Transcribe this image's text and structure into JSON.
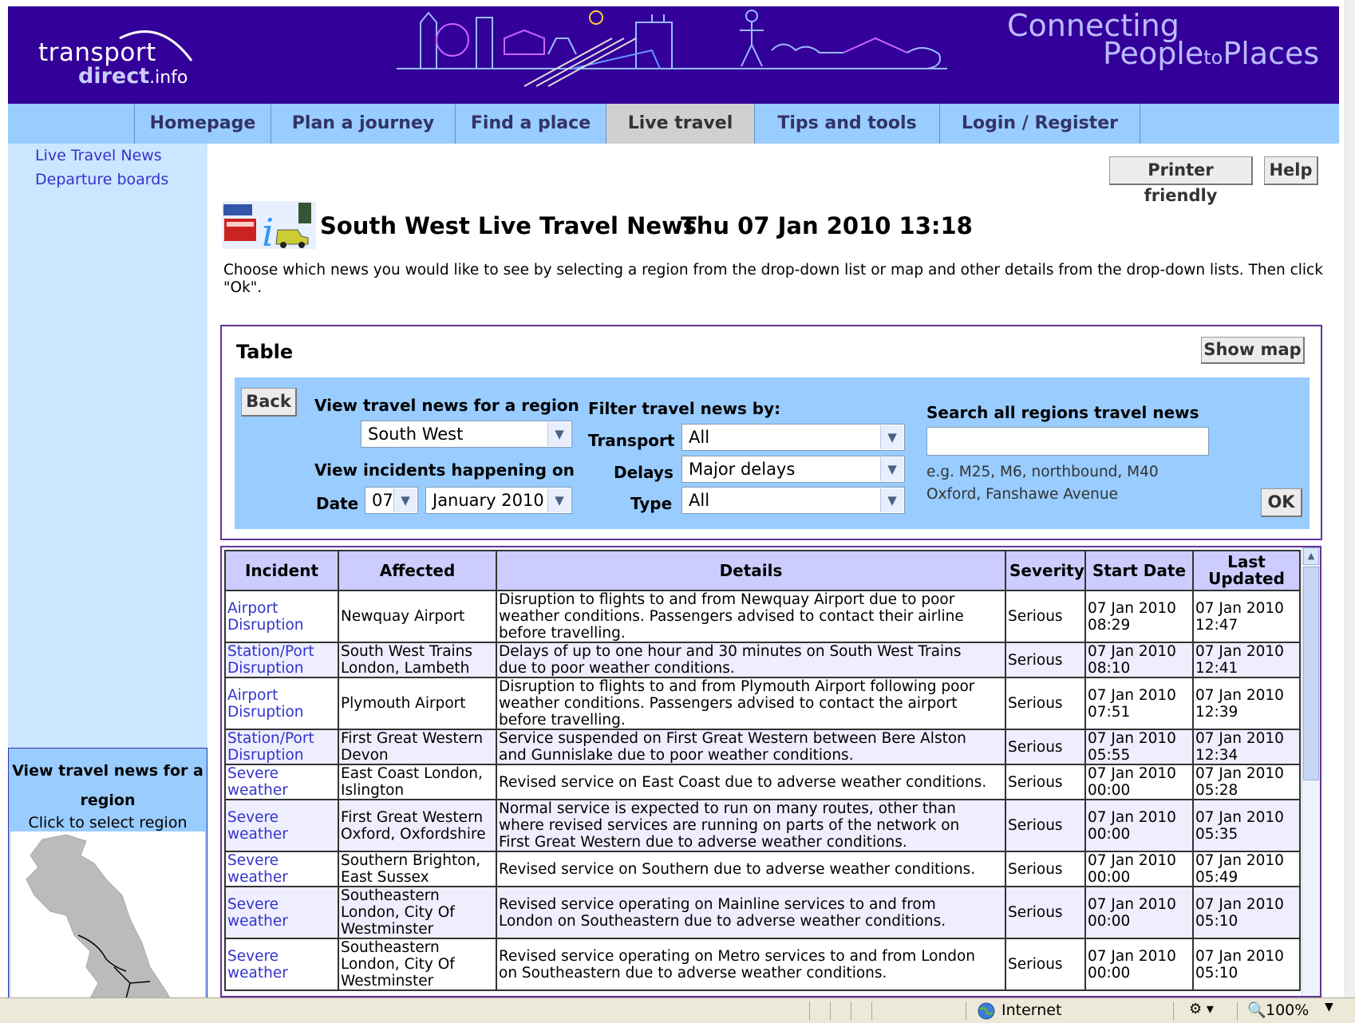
{
  "header": {
    "logo_line1": "transport",
    "logo_line2": "direct",
    "logo_suffix": ".info",
    "tagline_line1": "Connecting",
    "tagline_people": "People",
    "tagline_to": "to",
    "tagline_places": "Places",
    "colors": {
      "banner": "#330099",
      "nav": "#99ccff"
    }
  },
  "nav": {
    "items": [
      {
        "label": "Homepage"
      },
      {
        "label": "Plan a journey"
      },
      {
        "label": "Find a place"
      },
      {
        "label": "Live travel",
        "active": true
      },
      {
        "label": "Tips and tools"
      },
      {
        "label": "Login / Register"
      }
    ]
  },
  "sidebar": {
    "links": [
      {
        "label": "Live Travel News"
      },
      {
        "label": "Departure boards"
      }
    ],
    "region_panel": {
      "title_line1": "View travel news for a",
      "title_line2": "region",
      "subtitle": "Click to select region"
    }
  },
  "toolbar": {
    "printer_friendly": "Printer friendly",
    "help": "Help"
  },
  "page": {
    "title": "South West Live Travel News",
    "datetime": "Thu 07 Jan 2010 13:18",
    "intro": "Choose which news you would like to see by selecting a region from the drop-down list or map and other details from the drop-down lists. Then click \"Ok\"."
  },
  "filter": {
    "heading": "Table",
    "show_map": "Show map",
    "back": "Back",
    "region_label": "View travel news for a region",
    "region_value": "South West",
    "incidents_label": "View incidents happening on",
    "date_label": "Date",
    "day_value": "07",
    "month_value": "January 2010",
    "filter_label": "Filter travel news by:",
    "transport_label": "Transport",
    "transport_value": "All",
    "delays_label": "Delays",
    "delays_value": "Major delays",
    "type_label": "Type",
    "type_value": "All",
    "search_label": "Search all regions travel news",
    "search_value": "",
    "hint_line1": "e.g. M25, M6, northbound, M40",
    "hint_line2": "Oxford, Fanshawe Avenue",
    "ok": "OK"
  },
  "table": {
    "headers": [
      "Incident",
      "Affected",
      "Details",
      "Severity",
      "Start Date",
      "Last Updated"
    ],
    "rows": [
      {
        "incident": [
          "Airport",
          "Disruption"
        ],
        "affected": [
          "Newquay Airport"
        ],
        "details": [
          "Disruption to flights to and from Newquay Airport due to poor",
          "weather conditions. Passengers advised to contact their airline",
          "before travelling."
        ],
        "severity": "Serious",
        "start": [
          "07 Jan 2010",
          "08:29"
        ],
        "updated": [
          "07 Jan 2010",
          "12:47"
        ]
      },
      {
        "incident": [
          "Station/Port",
          "Disruption"
        ],
        "affected": [
          "South West Trains",
          "London, Lambeth"
        ],
        "details": [
          "Delays of up to one hour and 30 minutes on South West Trains",
          "due to poor weather conditions."
        ],
        "severity": "Serious",
        "start": [
          "07 Jan 2010",
          "08:10"
        ],
        "updated": [
          "07 Jan 2010",
          "12:41"
        ]
      },
      {
        "incident": [
          "Airport",
          "Disruption"
        ],
        "affected": [
          "Plymouth Airport"
        ],
        "details": [
          "Disruption to flights to and from Plymouth Airport following poor",
          "weather conditions. Passengers advised to contact the airport",
          "before travelling."
        ],
        "severity": "Serious",
        "start": [
          "07 Jan 2010",
          "07:51"
        ],
        "updated": [
          "07 Jan 2010",
          "12:39"
        ]
      },
      {
        "incident": [
          "Station/Port",
          "Disruption"
        ],
        "affected": [
          "First Great Western",
          "Devon"
        ],
        "details": [
          "Service suspended on First Great Western between Bere Alston",
          "and Gunnislake due to poor weather conditions."
        ],
        "severity": "Serious",
        "start": [
          "07 Jan 2010",
          "05:55"
        ],
        "updated": [
          "07 Jan 2010",
          "12:34"
        ]
      },
      {
        "incident": [
          "Severe",
          "weather"
        ],
        "affected": [
          "East Coast London,",
          "Islington"
        ],
        "details": [
          "Revised service on East Coast due to adverse weather conditions."
        ],
        "severity": "Serious",
        "start": [
          "07 Jan 2010",
          "00:00"
        ],
        "updated": [
          "07 Jan 2010",
          "05:28"
        ]
      },
      {
        "incident": [
          "Severe",
          "weather"
        ],
        "affected": [
          "First Great Western",
          "Oxford, Oxfordshire"
        ],
        "details": [
          "Normal service is expected to run on many routes, other than",
          "where revised services are running on parts of the network on",
          "First Great Western due to adverse weather conditions."
        ],
        "severity": "Serious",
        "start": [
          "07 Jan 2010",
          "00:00"
        ],
        "updated": [
          "07 Jan 2010",
          "05:35"
        ]
      },
      {
        "incident": [
          "Severe",
          "weather"
        ],
        "affected": [
          "Southern Brighton,",
          "East Sussex"
        ],
        "details": [
          "Revised service on Southern due to adverse weather conditions."
        ],
        "severity": "Serious",
        "start": [
          "07 Jan 2010",
          "00:00"
        ],
        "updated": [
          "07 Jan 2010",
          "05:49"
        ]
      },
      {
        "incident": [
          "Severe",
          "weather"
        ],
        "affected": [
          "Southeastern",
          "London, City Of",
          "Westminster"
        ],
        "details": [
          "Revised service operating on Mainline services to and from",
          "London on Southeastern due to adverse weather conditions."
        ],
        "severity": "Serious",
        "start": [
          "07 Jan 2010",
          "00:00"
        ],
        "updated": [
          "07 Jan 2010",
          "05:10"
        ]
      },
      {
        "incident": [
          "Severe",
          "weather"
        ],
        "affected": [
          "Southeastern",
          "London, City Of",
          "Westminster"
        ],
        "details": [
          "Revised service operating on Metro services to and from London",
          "on Southeastern due to adverse weather conditions."
        ],
        "severity": "Serious",
        "start": [
          "07 Jan 2010",
          "00:00"
        ],
        "updated": [
          "07 Jan 2010",
          "05:10"
        ]
      }
    ]
  },
  "statusbar": {
    "zone": "Internet",
    "zoom": "100%"
  }
}
